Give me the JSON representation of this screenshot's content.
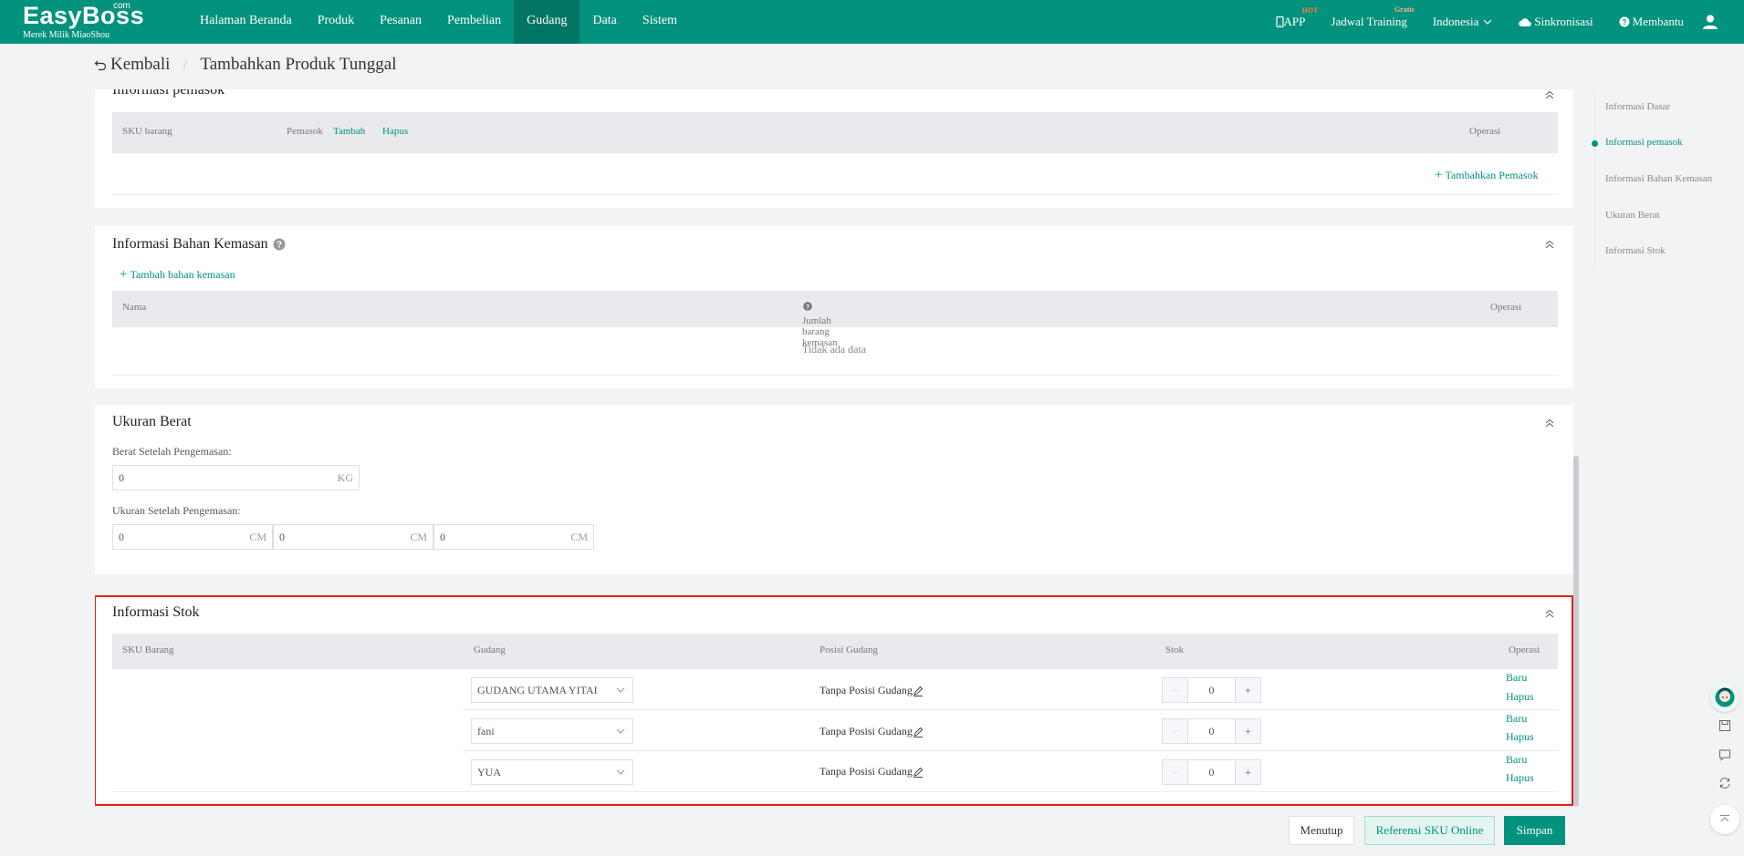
{
  "nav": {
    "logo": "EasyBoss",
    "logo_com": "com",
    "logo_sub": "Merek Milik MiaoShou",
    "menu": [
      "Halaman Beranda",
      "Produk",
      "Pesanan",
      "Pembelian",
      "Gudang",
      "Data",
      "Sistem"
    ],
    "active_menu": "Gudang",
    "app": "APP",
    "app_badge": "HOT",
    "training": "Jadwal Training",
    "training_badge": "Gratis",
    "language": "Indonesia",
    "sync": "Sinkronisasi",
    "help": "Membantu"
  },
  "breadcrumb": {
    "back": "Kembali",
    "title": "Tambahkan Produk Tunggal"
  },
  "supplier": {
    "title": "Informasi pemasok",
    "headers": {
      "sku": "SKU barang",
      "supplier": "Pemasok",
      "add": "Tambah",
      "delete": "Hapus",
      "operation": "Operasi"
    },
    "add_supplier": "Tambahkan Pemasok"
  },
  "packaging": {
    "title": "Informasi Bahan Kemasan",
    "add_packaging": "Tambah bahan kemasan",
    "headers": {
      "name": "Nama",
      "qty": "Jumlah barang kemasan",
      "operation": "Operasi"
    },
    "empty": "Tidak ada data"
  },
  "weight": {
    "title": "Ukuran Berat",
    "weight_label": "Berat Setelah Pengemasan:",
    "weight_value": "0",
    "weight_unit": "KG",
    "size_label": "Ukuran Setelah Pengemasan:",
    "size_values": [
      "0",
      "0",
      "0"
    ],
    "size_unit": "CM"
  },
  "stock": {
    "title": "Informasi Stok",
    "headers": {
      "sku": "SKU Barang",
      "warehouse": "Gudang",
      "position": "Posisi Gudang",
      "stock": "Stok",
      "operation": "Operasi"
    },
    "rows": [
      {
        "warehouse": "GUDANG UTAMA YITAI",
        "position": "Tanpa Posisi Gudang",
        "stock": "0",
        "new": "Baru",
        "delete": "Hapus"
      },
      {
        "warehouse": "fani",
        "position": "Tanpa Posisi Gudang",
        "stock": "0",
        "new": "Baru",
        "delete": "Hapus"
      },
      {
        "warehouse": "YUA",
        "position": "Tanpa Posisi Gudang",
        "stock": "0",
        "new": "Baru",
        "delete": "Hapus"
      }
    ]
  },
  "footer": {
    "close": "Menutup",
    "reference": "Referensi SKU Online",
    "save": "Simpan"
  },
  "anchors": [
    "Informasi Dasar",
    "Informasi pemasok",
    "Informasi Bahan Kemasan",
    "Ukuran Berat",
    "Informasi Stok"
  ],
  "active_anchor": "Informasi pemasok",
  "colors": {
    "primary": "#03927d",
    "highlight_border": "#e02020"
  }
}
